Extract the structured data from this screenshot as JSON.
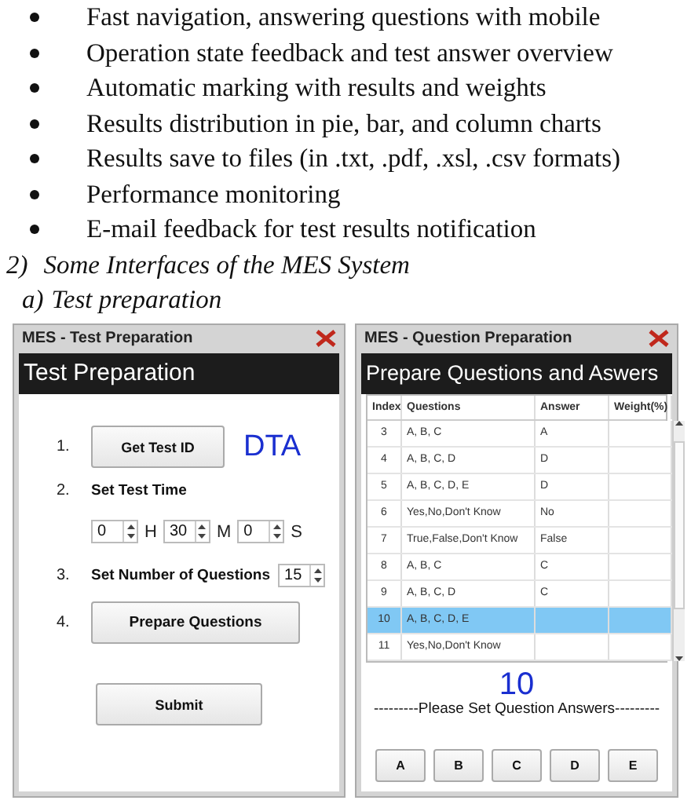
{
  "bullets": [
    "Fast navigation, answering questions with mobile",
    "Operation state feedback and test answer overview",
    "Automatic marking with results and weights",
    "Results distribution in pie, bar, and column charts",
    "Results save to files (in .txt, .pdf, .xsl, .csv formats)",
    "Performance monitoring",
    "E-mail feedback for test results notification"
  ],
  "section": {
    "number": "2)",
    "title": "Some Interfaces of the MES System"
  },
  "subsection": {
    "number": "a)",
    "title": "Test preparation"
  },
  "test_window": {
    "title": "MES - Test Preparation",
    "header": "Test Preparation",
    "step_1": {
      "number": "1.",
      "button": "Get Test ID",
      "test_id": "DTA"
    },
    "step_2": {
      "number": "2.",
      "label": "Set Test Time",
      "fields": [
        {
          "value": "0",
          "unit": "H"
        },
        {
          "value": "30",
          "unit": "M"
        },
        {
          "value": "0",
          "unit": "S"
        }
      ]
    },
    "step_3": {
      "number": "3.",
      "label": "Set Number of Questions",
      "value": "15"
    },
    "step_4": {
      "number": "4.",
      "button": "Prepare Questions"
    },
    "submit": "Submit"
  },
  "question_window": {
    "title": "MES - Question Preparation",
    "header": "Prepare Questions and Aswers",
    "table": {
      "columns": [
        "Index",
        "Questions",
        "Answer",
        "Weight(%)"
      ],
      "rows": [
        {
          "cells": [
            "3",
            "A, B, C",
            "A",
            ""
          ],
          "selected": false
        },
        {
          "cells": [
            "4",
            "A, B, C, D",
            "D",
            ""
          ],
          "selected": false
        },
        {
          "cells": [
            "5",
            "A, B, C, D, E",
            "D",
            ""
          ],
          "selected": false
        },
        {
          "cells": [
            "6",
            "Yes,No,Don't Know",
            "No",
            ""
          ],
          "selected": false
        },
        {
          "cells": [
            "7",
            "True,False,Don't Know",
            "False",
            ""
          ],
          "selected": false
        },
        {
          "cells": [
            "8",
            "A, B, C",
            "C",
            ""
          ],
          "selected": false
        },
        {
          "cells": [
            "9",
            "A, B, C, D",
            "C",
            ""
          ],
          "selected": false
        },
        {
          "cells": [
            "10",
            "A, B, C, D, E",
            "",
            ""
          ],
          "selected": true
        },
        {
          "cells": [
            "11",
            "Yes,No,Don't Know",
            "",
            ""
          ],
          "selected": false
        }
      ]
    },
    "current": "10",
    "prompt": "---------Please Set Question Answers---------",
    "answer_buttons": [
      "A",
      "B",
      "C",
      "D",
      "E"
    ]
  }
}
